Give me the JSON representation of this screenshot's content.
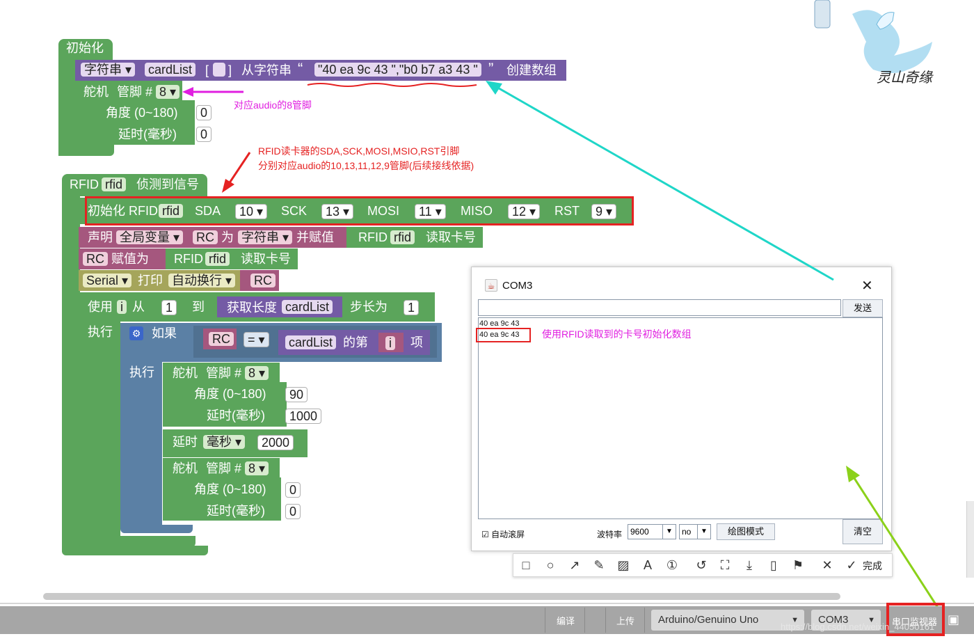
{
  "blocks": {
    "init": {
      "header": "初始化",
      "array_type": "字符串",
      "array_name": "cardList",
      "bracket_open": "[",
      "bracket_close": "]",
      "from_string": "从字符串",
      "quote_open": "“",
      "quote_close": "”",
      "string_value": "\"40 ea 9c 43 \",\"b0 b7 a3 43 \"",
      "create_array": "创建数组",
      "servo_label": "舵机",
      "pin_label": "管脚 #",
      "servo_pin": "8",
      "angle_label": "角度 (0~180)",
      "angle_value": "0",
      "delay_label": "延时(毫秒)",
      "delay_value": "0"
    },
    "rfid": {
      "header_prefix": "RFID",
      "header_var": "rfid",
      "header_suffix": "侦测到信号",
      "init_label": "初始化 RFID",
      "init_var": "rfid",
      "sda_label": "SDA",
      "sda": "10",
      "sck_label": "SCK",
      "sck": "13",
      "mosi_label": "MOSI",
      "mosi": "11",
      "miso_label": "MISO",
      "miso": "12",
      "rst_label": "RST",
      "rst": "9",
      "declare_label": "声明",
      "scope": "全局变量",
      "var_rc": "RC",
      "as_label": "为",
      "type_str": "字符串",
      "assign_label": "并赋值",
      "read_prefix": "RFID",
      "read_var": "rfid",
      "read_card": "读取卡号",
      "assign_to": "赋值为",
      "serial": "Serial",
      "print_label": "打印",
      "newline": "自动换行",
      "for_use": "使用",
      "for_var": "i",
      "from_label": "从",
      "from_value": "1",
      "to_label": "到",
      "get_length": "获取长度",
      "length_var": "cardList",
      "step_label": "步长为",
      "step_value": "1",
      "do_label": "执行",
      "if_label": "如果",
      "eq": "=",
      "list_var": "cardList",
      "nth_label": "的第",
      "item_label": "项",
      "servo_pin_1": "8",
      "angle_1": "90",
      "delay_1": "1000",
      "wait_label": "延时",
      "wait_unit": "毫秒",
      "wait_value": "2000",
      "servo_pin_2": "8",
      "angle_2": "0",
      "delay_2": "0"
    }
  },
  "annotations": {
    "audio8": "对应audio的8管脚",
    "rfid_line1": "RFID读卡器的SDA,SCK,MOSI,MSIO,RST引脚",
    "rfid_line2": "分别对应audio的10,13,11,12,9管脚(后续接线依据)",
    "serial_note": "使用RFID读取到的卡号初始化数组"
  },
  "serial_monitor": {
    "title": "COM3",
    "send": "发送",
    "lines": [
      "40 ea 9c 43",
      "40 ea 9c 43"
    ],
    "autoscroll": "自动滚屏",
    "baud_label": "波特率",
    "baud": "9600",
    "line_ending": "no",
    "plot_mode": "绘图模式",
    "clear": "清空"
  },
  "toolbar": {
    "done": "完成"
  },
  "statusbar": {
    "compile": "编译",
    "upload": "上传",
    "board": "Arduino/Genuino Uno",
    "port": "COM3",
    "serial_monitor": "串口监视器",
    "watermark": "https://blog.csdn.net/weixin_44050161"
  },
  "colors": {
    "logic_green": "#5ba55b",
    "array_purple": "#745ba5",
    "variable_pink": "#a5577e",
    "serial_olive": "#a5a55b",
    "control_blue": "#5b80a5",
    "highlight_red": "#e52222",
    "annotation_magenta": "#e01fe0"
  }
}
